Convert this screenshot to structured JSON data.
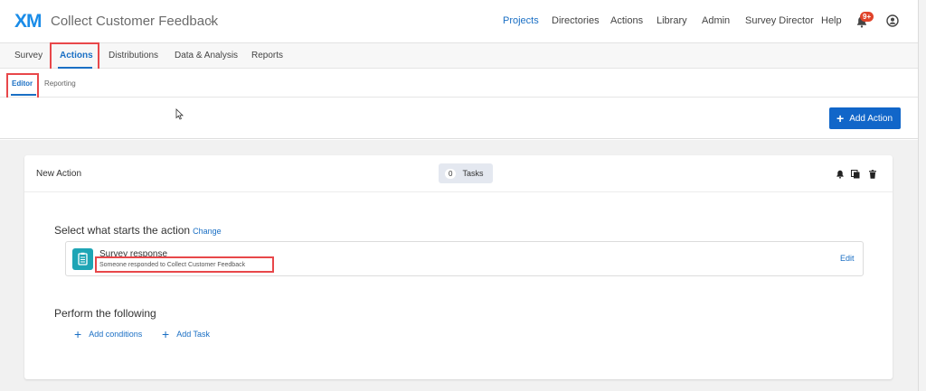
{
  "header": {
    "logo": "XM",
    "project_title": "Collect Customer Feedback",
    "caret": "⌄",
    "nav": [
      "Projects",
      "Directories",
      "Actions",
      "Library",
      "Admin",
      "Survey Director",
      "Help"
    ],
    "notification_badge": "9+",
    "accent_color": "#1a6fc4"
  },
  "tabs": [
    "Survey",
    "Actions",
    "Distributions",
    "Data & Analysis",
    "Reports"
  ],
  "active_tab": "Actions",
  "subtabs": [
    "Editor",
    "Reporting"
  ],
  "active_subtab": "Editor",
  "toolbar": {
    "add_action_label": "Add Action"
  },
  "action_card": {
    "title": "New Action",
    "tasks_count": "0",
    "tasks_label": "Tasks",
    "start_section_title": "Select what starts the action",
    "change_link": "Change",
    "trigger": {
      "title": "Survey response",
      "description": "Someone responded to Collect Customer Feedback",
      "edit_label": "Edit"
    },
    "perform_section_title": "Perform the following",
    "add_conditions_label": "Add conditions",
    "add_task_label": "Add Task"
  },
  "icons": [
    "bell-icon",
    "user-icon",
    "plus-icon",
    "notification-bell-icon",
    "copy-icon",
    "trash-icon",
    "survey-response-icon",
    "cursor-icon"
  ]
}
